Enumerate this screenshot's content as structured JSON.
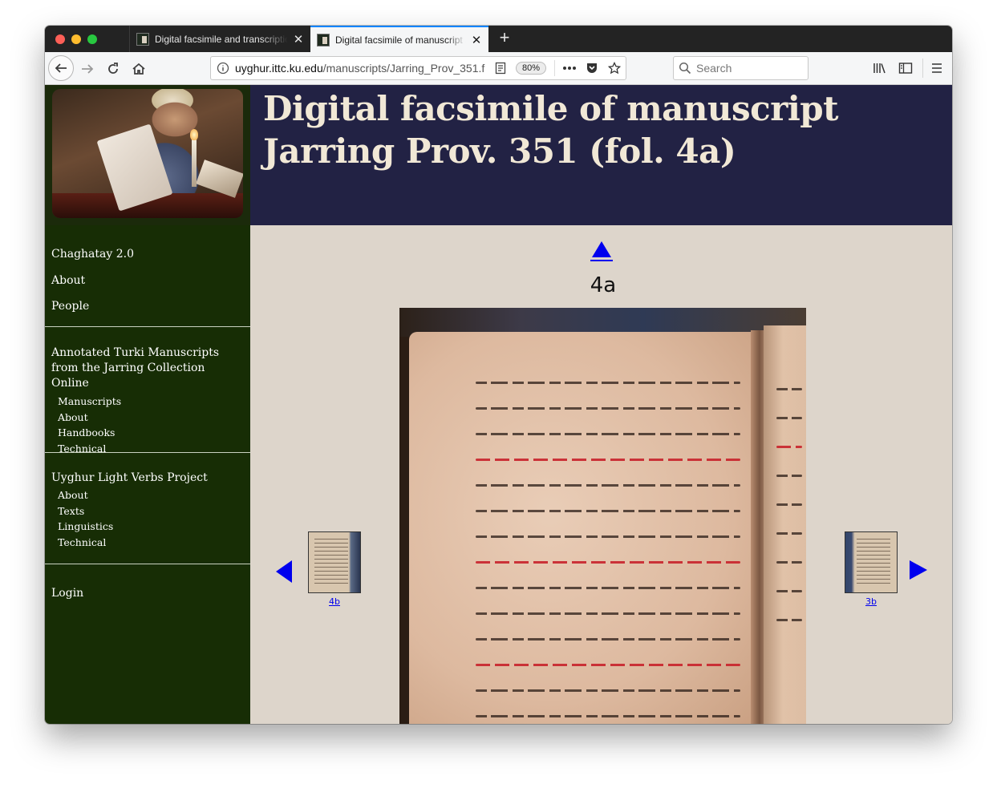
{
  "browser": {
    "tabs": [
      {
        "title": "Digital facsimile and transcriptio",
        "active": false
      },
      {
        "title": "Digital facsimile of manuscript J",
        "active": true
      }
    ],
    "url_host": "uyghur.ittc.ku.edu",
    "url_path": "/manuscripts/Jarring_Prov_351.f",
    "zoom": "80%",
    "search_placeholder": "Search",
    "new_tab_label": "+"
  },
  "header": {
    "title": "Digital facsimile of manuscript Jarring Prov. 351 (fol. 4a)"
  },
  "sidebar": {
    "top_items": [
      "Chaghatay 2.0",
      "About",
      "People"
    ],
    "jarring": {
      "heading": "Annotated Turki Manuscripts from the Jarring Collection Online",
      "items": [
        "Manuscripts",
        "About",
        "Handbooks",
        "Technical"
      ]
    },
    "uyghur": {
      "heading": "Uyghur Light Verbs Project",
      "items": [
        "About",
        "Texts",
        "Linguistics",
        "Technical"
      ]
    },
    "login": "Login"
  },
  "viewer": {
    "folio": "4a",
    "prev_label": "4b",
    "next_label": "3b"
  },
  "colors": {
    "title_bg": "#222244",
    "sidebar_bg": "#172d05",
    "content_bg": "#ddd5cb",
    "link": "#0000ee"
  }
}
